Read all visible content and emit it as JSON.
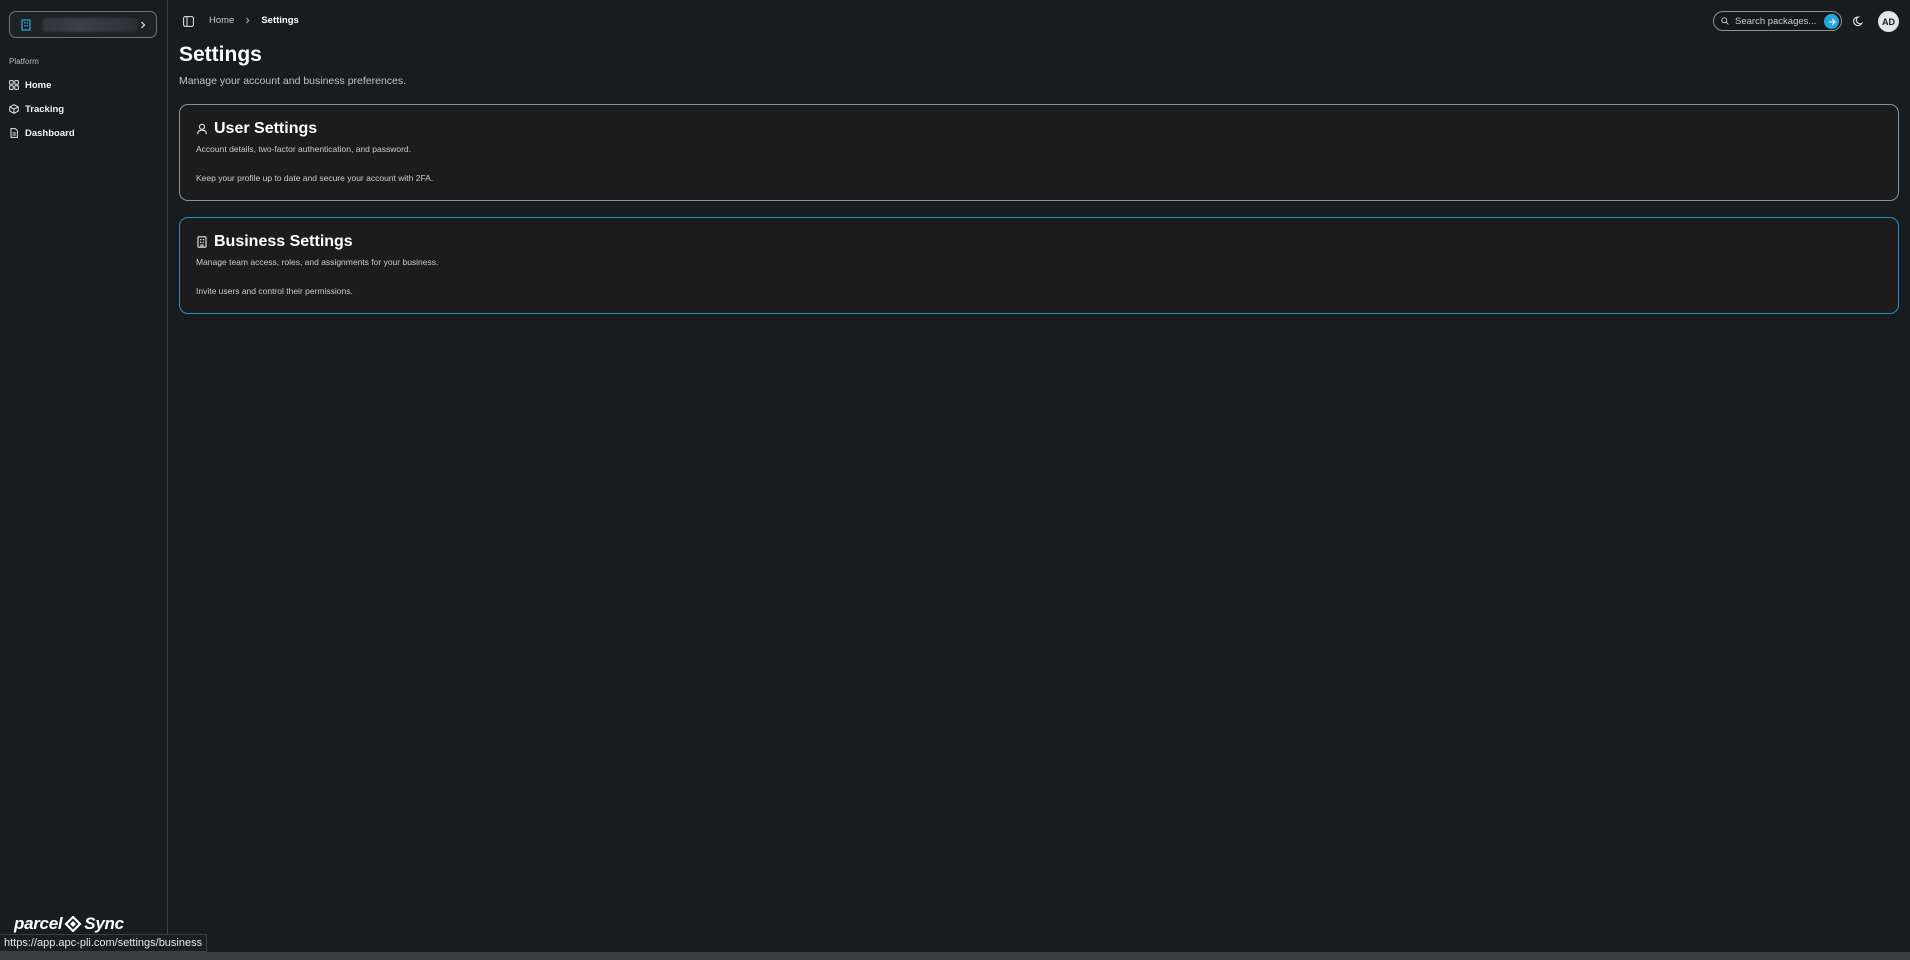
{
  "sidebar": {
    "business_name": "",
    "section_label": "Platform",
    "items": [
      {
        "label": "Home",
        "icon": "grid-icon"
      },
      {
        "label": "Tracking",
        "icon": "package-icon"
      },
      {
        "label": "Dashboard",
        "icon": "file-icon"
      }
    ],
    "brand_left": "parcel",
    "brand_right": "Sync"
  },
  "breadcrumb": {
    "home": "Home",
    "current": "Settings"
  },
  "header": {
    "search_placeholder": "Search packages...",
    "avatar_initials": "AD"
  },
  "main": {
    "title": "Settings",
    "subtitle": "Manage your account and business preferences.",
    "cards": [
      {
        "title": "User Settings",
        "description": "Account details, two-factor authentication, and password.",
        "note": "Keep your profile up to date and secure your account with 2FA."
      },
      {
        "title": "Business Settings",
        "description": "Manage team access, roles, and assignments for your business.",
        "note": "Invite users and control their permissions."
      }
    ]
  },
  "status_url": "https://app.apc-pli.com/settings/business",
  "colors": {
    "background": "#181c1e",
    "accent": "#27a6db",
    "active_card_border": "#2b8fc2"
  }
}
